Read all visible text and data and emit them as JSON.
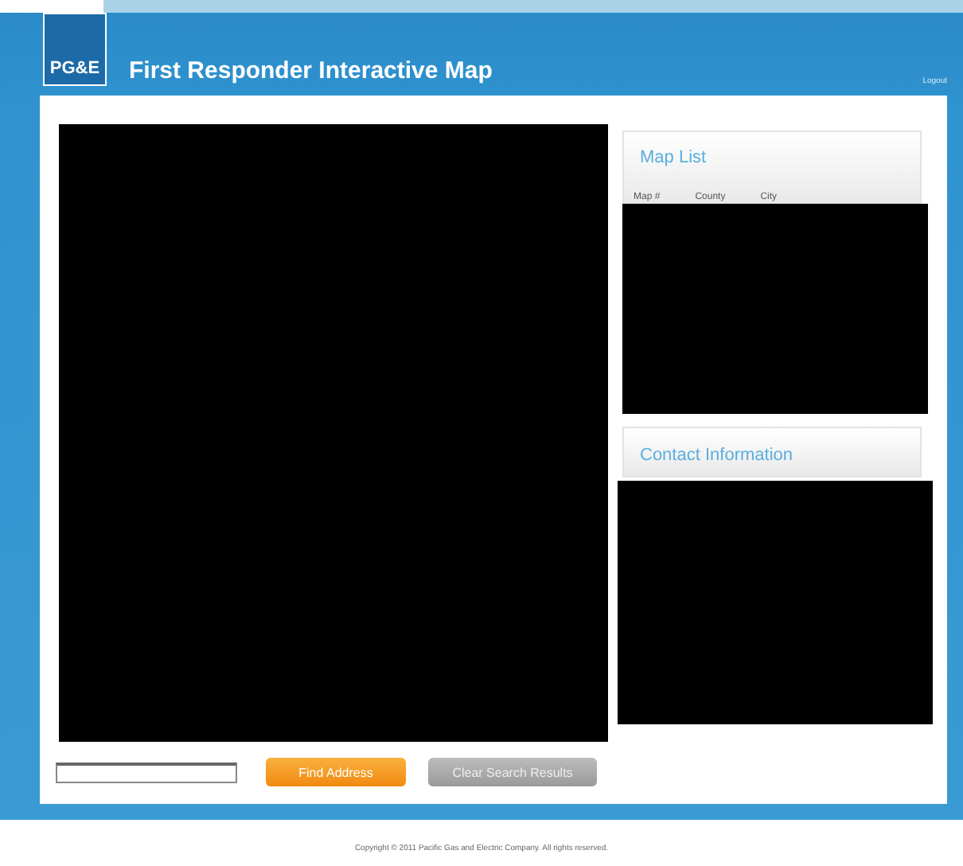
{
  "header": {
    "logo": "PG&E",
    "title": "First Responder Interactive Map",
    "logout": "Logout"
  },
  "map_list": {
    "title": "Map List",
    "columns": [
      "Map #",
      "County",
      "City"
    ]
  },
  "contact": {
    "title": "Contact Information"
  },
  "buttons": [
    {
      "label": "Find Address",
      "kind": "primary"
    },
    {
      "label": "Clear Search Results",
      "kind": "secondary"
    }
  ],
  "footer": "Copyright © 2011 Pacific Gas and Electric Company. All rights reserved."
}
